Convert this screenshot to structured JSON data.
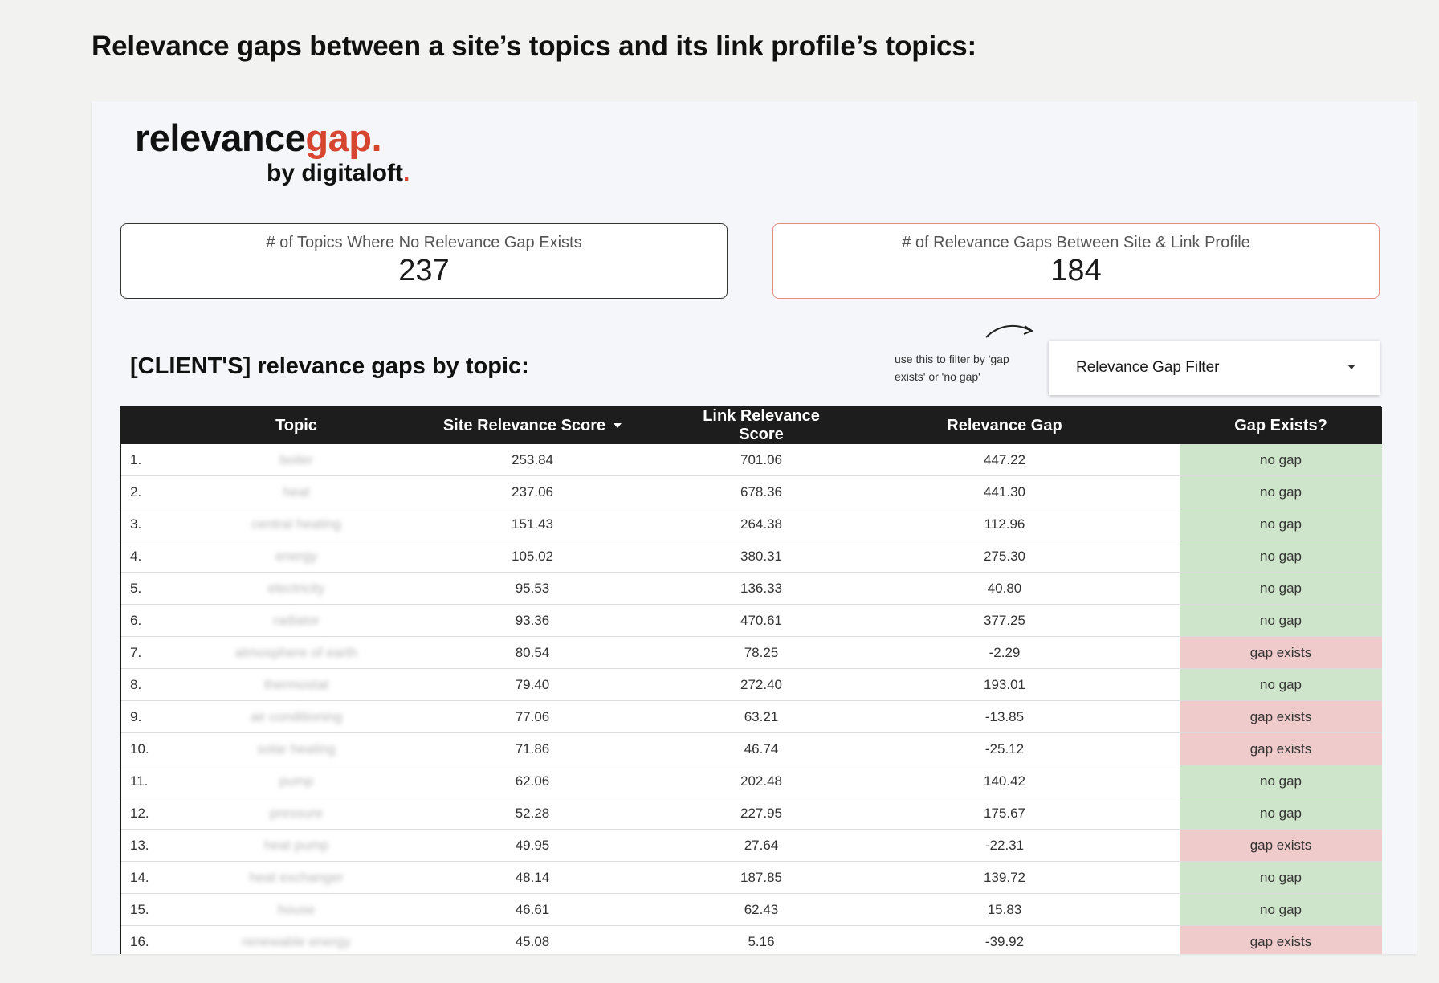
{
  "page": {
    "heading": "Relevance gaps between a site’s topics and its link profile’s topics:"
  },
  "logo": {
    "main_dark": "relevance",
    "main_accent": "gap.",
    "sub_text": "by digitaloft",
    "sub_dot": ".",
    "accent_color": "#d64530"
  },
  "kpis": {
    "no_gap": {
      "label": "# of Topics Where No Relevance Gap Exists",
      "value": "237"
    },
    "gaps": {
      "label": "# of Relevance Gaps Between Site & Link Profile",
      "value": "184"
    }
  },
  "section": {
    "title": "[CLIENT'S] relevance gaps by topic:"
  },
  "filter": {
    "hint": "use this to filter by 'gap exists' or 'no gap'",
    "label": "Relevance Gap Filter"
  },
  "table": {
    "columns": [
      "",
      "Topic",
      "Site Relevance Score",
      "Link Relevance Score",
      "Relevance Gap",
      "Gap Exists?"
    ],
    "sort_icon": "caret-down-icon",
    "colors": {
      "no_gap": "#cfe5cb",
      "gap_exists": "#efcccb",
      "header": "#1d1d1d"
    },
    "rows": [
      {
        "idx": "1.",
        "topic": "boiler",
        "site": "253.84",
        "link": "701.06",
        "gap": "447.22",
        "status": "no gap"
      },
      {
        "idx": "2.",
        "topic": "heat",
        "site": "237.06",
        "link": "678.36",
        "gap": "441.30",
        "status": "no gap"
      },
      {
        "idx": "3.",
        "topic": "central heating",
        "site": "151.43",
        "link": "264.38",
        "gap": "112.96",
        "status": "no gap"
      },
      {
        "idx": "4.",
        "topic": "energy",
        "site": "105.02",
        "link": "380.31",
        "gap": "275.30",
        "status": "no gap"
      },
      {
        "idx": "5.",
        "topic": "electricity",
        "site": "95.53",
        "link": "136.33",
        "gap": "40.80",
        "status": "no gap"
      },
      {
        "idx": "6.",
        "topic": "radiator",
        "site": "93.36",
        "link": "470.61",
        "gap": "377.25",
        "status": "no gap"
      },
      {
        "idx": "7.",
        "topic": "atmosphere of earth",
        "site": "80.54",
        "link": "78.25",
        "gap": "-2.29",
        "status": "gap exists"
      },
      {
        "idx": "8.",
        "topic": "thermostat",
        "site": "79.40",
        "link": "272.40",
        "gap": "193.01",
        "status": "no gap"
      },
      {
        "idx": "9.",
        "topic": "air conditioning",
        "site": "77.06",
        "link": "63.21",
        "gap": "-13.85",
        "status": "gap exists"
      },
      {
        "idx": "10.",
        "topic": "solar heating",
        "site": "71.86",
        "link": "46.74",
        "gap": "-25.12",
        "status": "gap exists"
      },
      {
        "idx": "11.",
        "topic": "pump",
        "site": "62.06",
        "link": "202.48",
        "gap": "140.42",
        "status": "no gap"
      },
      {
        "idx": "12.",
        "topic": "pressure",
        "site": "52.28",
        "link": "227.95",
        "gap": "175.67",
        "status": "no gap"
      },
      {
        "idx": "13.",
        "topic": "heat pump",
        "site": "49.95",
        "link": "27.64",
        "gap": "-22.31",
        "status": "gap exists"
      },
      {
        "idx": "14.",
        "topic": "heat exchanger",
        "site": "48.14",
        "link": "187.85",
        "gap": "139.72",
        "status": "no gap"
      },
      {
        "idx": "15.",
        "topic": "house",
        "site": "46.61",
        "link": "62.43",
        "gap": "15.83",
        "status": "no gap"
      },
      {
        "idx": "16.",
        "topic": "renewable energy",
        "site": "45.08",
        "link": "5.16",
        "gap": "-39.92",
        "status": "gap exists"
      }
    ]
  }
}
